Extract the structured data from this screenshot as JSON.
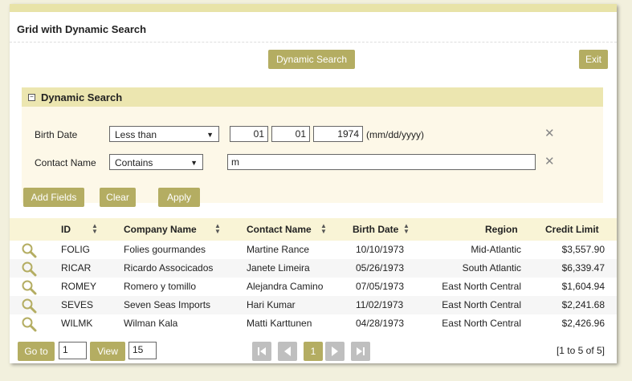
{
  "title": "Grid with Dynamic Search",
  "toolbar": {
    "dynamic_search_label": "Dynamic Search",
    "exit_label": "Exit"
  },
  "search": {
    "header": "Dynamic Search",
    "toggle": "−",
    "rows": [
      {
        "label": "Birth Date",
        "operator": "Less than",
        "month": "01",
        "day": "01",
        "year": "1974",
        "hint": "(mm/dd/yyyy)"
      },
      {
        "label": "Contact Name",
        "operator": "Contains",
        "value": "m"
      }
    ],
    "buttons": {
      "add_fields": "Add Fields",
      "clear": "Clear",
      "apply": "Apply"
    }
  },
  "grid": {
    "columns": [
      "ID",
      "Company Name",
      "Contact Name",
      "Birth Date",
      "Region",
      "Credit Limit"
    ],
    "rows": [
      {
        "id": "FOLIG",
        "company": "Folies gourmandes",
        "contact": "Martine Rance",
        "birth": "10/10/1973",
        "region": "Mid-Atlantic",
        "credit": "$3,557.90"
      },
      {
        "id": "RICAR",
        "company": "Ricardo Associcados",
        "contact": "Janete Limeira",
        "birth": "05/26/1973",
        "region": "South Atlantic",
        "credit": "$6,339.47"
      },
      {
        "id": "ROMEY",
        "company": "Romero y tomillo",
        "contact": "Alejandra Camino",
        "birth": "07/05/1973",
        "region": "East North Central",
        "credit": "$1,604.94"
      },
      {
        "id": "SEVES",
        "company": "Seven Seas Imports",
        "contact": "Hari Kumar",
        "birth": "11/02/1973",
        "region": "East North Central",
        "credit": "$2,241.68"
      },
      {
        "id": "WILMK",
        "company": "Wilman Kala",
        "contact": "Matti Karttunen",
        "birth": "04/28/1973",
        "region": "East North Central",
        "credit": "$2,426.96"
      }
    ]
  },
  "footer": {
    "goto_label": "Go to",
    "goto_value": "1",
    "view_label": "View",
    "view_value": "15",
    "current_page": "1",
    "summary": "[1 to 5 of 5]"
  },
  "colors": {
    "accent": "#b4ad62",
    "header_bg": "#ece6b0",
    "page_bg": "#f2f0dd"
  }
}
